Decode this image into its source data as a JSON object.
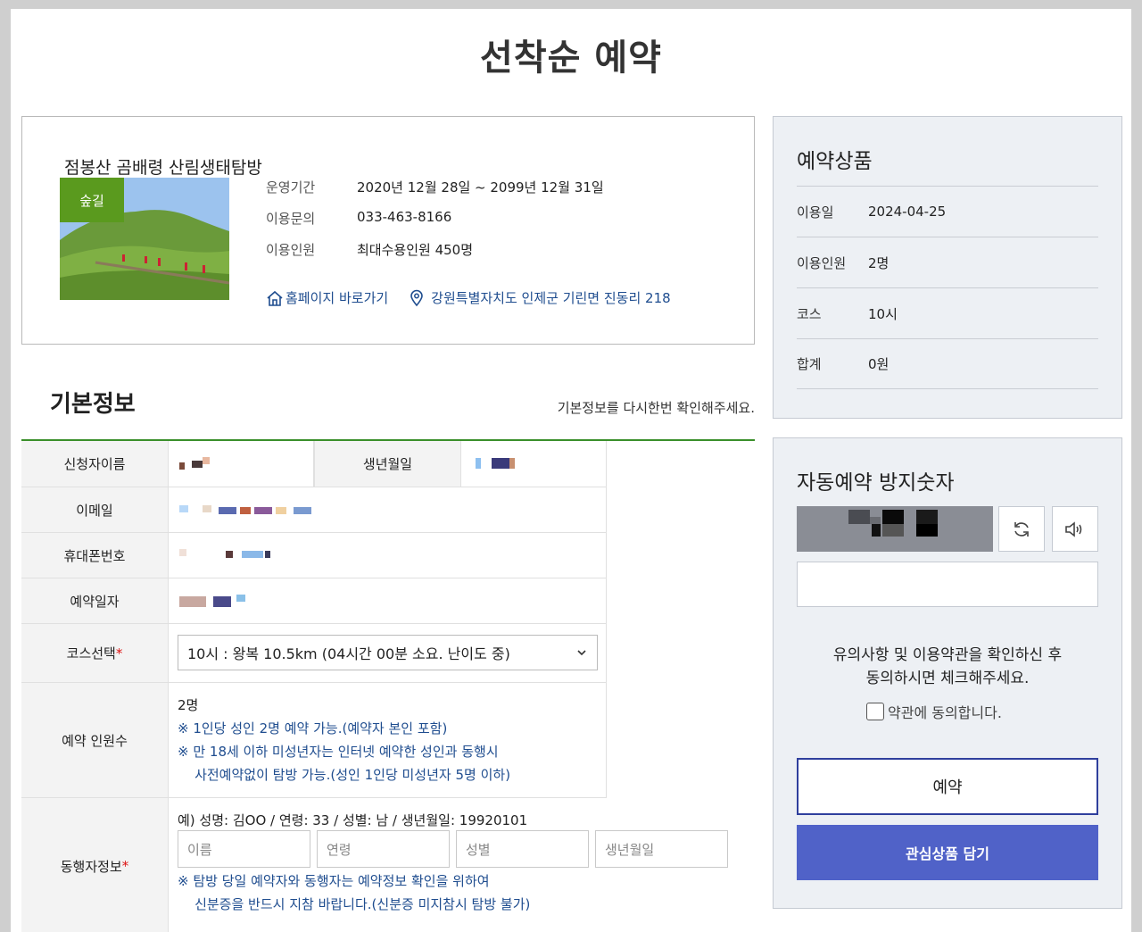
{
  "page_title": "선착순 예약",
  "product": {
    "name": "점봉산 곰배령 산림생태탐방",
    "badge": "숲길",
    "info": [
      {
        "key": "운영기간",
        "value": "2020년 12월 28일 ~ 2099년 12월 31일"
      },
      {
        "key": "이용문의",
        "value": "033-463-8166"
      },
      {
        "key": "이용인원",
        "value": "최대수용인원 450명"
      }
    ],
    "homepage_link": "홈페이지 바로가기",
    "address_link": "강원특별자치도 인제군 기린면 진동리 218"
  },
  "basic_info": {
    "title": "기본정보",
    "hint": "기본정보를 다시한번 확인해주세요.",
    "labels": {
      "applicant": "신청자이름",
      "birth": "생년월일",
      "email": "이메일",
      "phone": "휴대폰번호",
      "date": "예약일자",
      "course": "코스선택",
      "people": "예약 인원수",
      "companion": "동행자정보",
      "required_mark": "*"
    },
    "course_selected": "10시 : 왕복 10.5km (04시간 00분 소요. 난이도 중)",
    "people_count": "2명",
    "people_notes": [
      "※ 1인당 성인 2명 예약 가능.(예약자 본인 포함)",
      "※ 만 18세 이하 미성년자는 인터넷 예약한 성인과 동행시",
      "    사전예약없이 탐방 가능.(성인 1인당 미성년자 5명 이하)"
    ],
    "companion_example": "예) 성명: 김OO / 연령: 33 / 성별: 남 / 생년월일: 19920101",
    "companion_placeholders": {
      "name": "이름",
      "age": "연령",
      "gender": "성별",
      "birth": "생년월일"
    },
    "companion_notes": [
      "※ 탐방 당일 예약자와 동행자는 예약정보 확인을 위하여",
      "    신분증을 반드시 지참 바랍니다.(신분증 미지참시 탐방 불가)"
    ]
  },
  "summary": {
    "title": "예약상품",
    "rows": [
      {
        "key": "이용일",
        "value": "2024-04-25"
      },
      {
        "key": "이용인원",
        "value": "2명"
      },
      {
        "key": "코스",
        "value": "10시"
      },
      {
        "key": "합계",
        "value": "0원"
      }
    ]
  },
  "captcha": {
    "title": "자동예약 방지숫자",
    "agree_text_1": "유의사항 및 이용약관을 확인하신 후",
    "agree_text_2": "동의하시면 체크해주세요.",
    "agree_label": "약관에 동의합니다.",
    "reserve_button": "예약",
    "wishlist_button": "관심상품 담기"
  }
}
